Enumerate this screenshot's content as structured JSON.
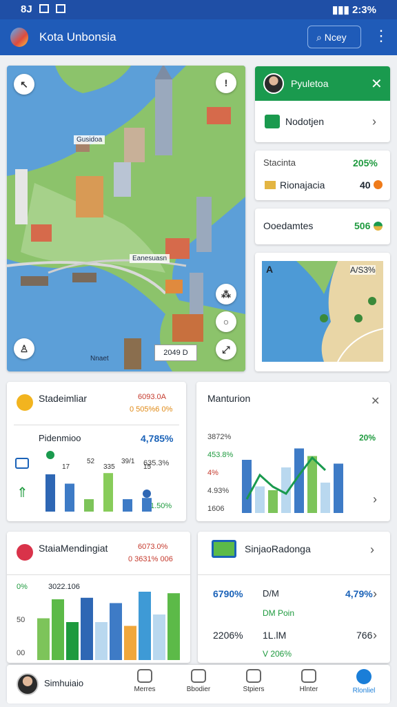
{
  "status_bar": {
    "left": "8J",
    "right": "2:3%"
  },
  "app_bar": {
    "title": "Kota Unbonsia",
    "search_label": "Ncey"
  },
  "map": {
    "label_top": "Gusidoa",
    "label_bottom": "Eanesuasn",
    "label_corner": "Nnaet",
    "zoom": "2049 D"
  },
  "profile_card": {
    "title": "Pyuletoa",
    "item": "Nodotjen"
  },
  "stats_card": {
    "label": "Stacinta",
    "value": "205%",
    "item": "Rionajacia",
    "item_value": "40"
  },
  "coord_card": {
    "label": "Ooedamtes",
    "value": "506"
  },
  "mini_map": {
    "label": "A",
    "value": "A/S3%"
  },
  "stat_chart": {
    "title": "Stadeimliar",
    "badge1": "6093.0A",
    "badge2": "0 505%6 0%",
    "subtitle": "Pidenmioo",
    "percent": "4,785%",
    "right_label": "635.3%",
    "corner": "1.50%",
    "bar_labels": [
      "17",
      "52",
      "335",
      "39/1",
      "15"
    ],
    "chart_data": {
      "type": "bar",
      "values": [
        60,
        45,
        20,
        62,
        20,
        22
      ],
      "colors": [
        "#2e67b4",
        "#3e7bc6",
        "#7dc45a",
        "#88cc5a",
        "#3e7bc6",
        "#3e7bc6"
      ]
    }
  },
  "manturion": {
    "title": "Manturion",
    "left_ticks": [
      "3872%",
      "453.8%",
      "4%",
      "4.93%",
      "1606"
    ],
    "right_tick": "20%",
    "chart_data": {
      "type": "bar",
      "values": [
        70,
        35,
        30,
        60,
        85,
        75,
        40,
        65
      ],
      "colors": [
        "#3e7bc6",
        "#b9d8ef",
        "#7dc45a",
        "#b9d8ef",
        "#3e7bc6",
        "#7dc45a",
        "#b9d8ef",
        "#3e7bc6"
      ],
      "line": [
        20,
        55,
        38,
        28,
        55,
        80,
        62
      ]
    }
  },
  "sales_card": {
    "title": "StaiaMendingiat",
    "badge1": "6073.0%",
    "badge2": "0 3631% 006",
    "ticks": [
      "0%",
      "50",
      "00"
    ],
    "label": "3022.106",
    "chart_data": {
      "type": "bar",
      "values": [
        55,
        80,
        50,
        82,
        50,
        75,
        45,
        90,
        60,
        88
      ],
      "colors": [
        "#7dc45a",
        "#5cba48",
        "#1e9a3e",
        "#2e67b4",
        "#b9d8ef",
        "#3e7bc6",
        "#f0a73c",
        "#3e9ad6",
        "#b9d8ef",
        "#5cba48"
      ]
    }
  },
  "region_card": {
    "title": "SinjaoRadonga",
    "r1_left": "6790%",
    "r1_mid": "D/M",
    "r1_right": "4,79%",
    "r2_mid": "DM Poin",
    "r3_left": "2206%",
    "r3_mid": "1L.lM",
    "r3_right": "766",
    "r4": "V 206%"
  },
  "nav": {
    "user": "Simhuiaio",
    "items": [
      "Merres",
      "Bbodier",
      "Stpiers",
      "Hlnter",
      "Rlonliel"
    ]
  }
}
